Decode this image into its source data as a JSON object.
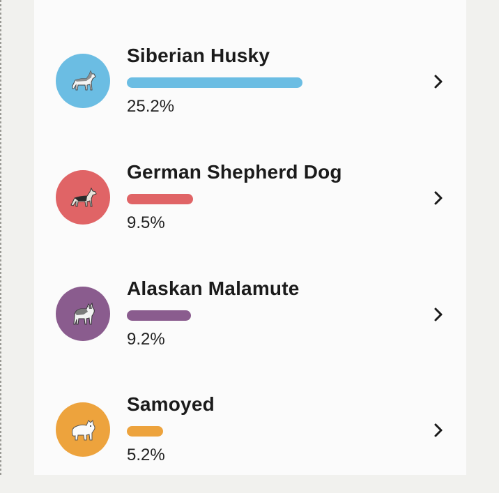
{
  "breeds": [
    {
      "name": "Siberian Husky",
      "percent": "25.2%",
      "share": 0.252,
      "color": "#6bbde3",
      "icon": "husky-icon"
    },
    {
      "name": "German Shepherd Dog",
      "percent": "9.5%",
      "share": 0.095,
      "color": "#e06466",
      "icon": "german-shepherd-icon"
    },
    {
      "name": "Alaskan Malamute",
      "percent": "9.2%",
      "share": 0.092,
      "color": "#8a5c8e",
      "icon": "malamute-icon"
    },
    {
      "name": "Samoyed",
      "percent": "5.2%",
      "share": 0.052,
      "color": "#eda33d",
      "icon": "samoyed-icon"
    }
  ]
}
